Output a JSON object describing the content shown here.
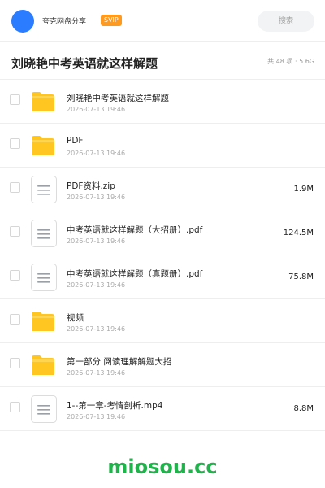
{
  "topbar": {
    "brand": "夸克网盘分享",
    "badge": "SVIP",
    "search_placeholder": "搜索",
    "accent": "#2b7cff"
  },
  "header": {
    "title": "刘晓艳中考英语就这样解题",
    "summary": "共 48 项 · 5.6G"
  },
  "files": [
    {
      "type": "folder",
      "icon": "folder-icon",
      "name": "刘晓艳中考英语就这样解题",
      "date": "2026-07-13 19:46",
      "size": ""
    },
    {
      "type": "folder",
      "icon": "folder-icon",
      "name": "PDF",
      "date": "2026-07-13 19:46",
      "size": ""
    },
    {
      "type": "file",
      "icon": "document-icon",
      "name": "PDF资料.zip",
      "date": "2026-07-13 19:46",
      "size": "1.9M"
    },
    {
      "type": "file",
      "icon": "document-icon",
      "name": "中考英语就这样解题（大招册）.pdf",
      "date": "2026-07-13 19:46",
      "size": "124.5M"
    },
    {
      "type": "file",
      "icon": "document-icon",
      "name": "中考英语就这样解题（真题册）.pdf",
      "date": "2026-07-13 19:46",
      "size": "75.8M"
    },
    {
      "type": "folder",
      "icon": "folder-icon",
      "name": "视频",
      "date": "2026-07-13 19:46",
      "size": ""
    },
    {
      "type": "folder",
      "icon": "folder-icon",
      "name": "第一部分 阅读理解解题大招",
      "date": "2026-07-13 19:46",
      "size": ""
    },
    {
      "type": "file",
      "icon": "document-icon",
      "name": "1--第一章-考情剖析.mp4",
      "date": "2026-07-13 19:46",
      "size": "8.8M"
    }
  ],
  "watermark": "miosou.cc",
  "colors": {
    "folder": "#ffc520",
    "folder_tab": "#ffd54f",
    "watermark": "#21b34b",
    "badge": "#ff9a1f"
  }
}
